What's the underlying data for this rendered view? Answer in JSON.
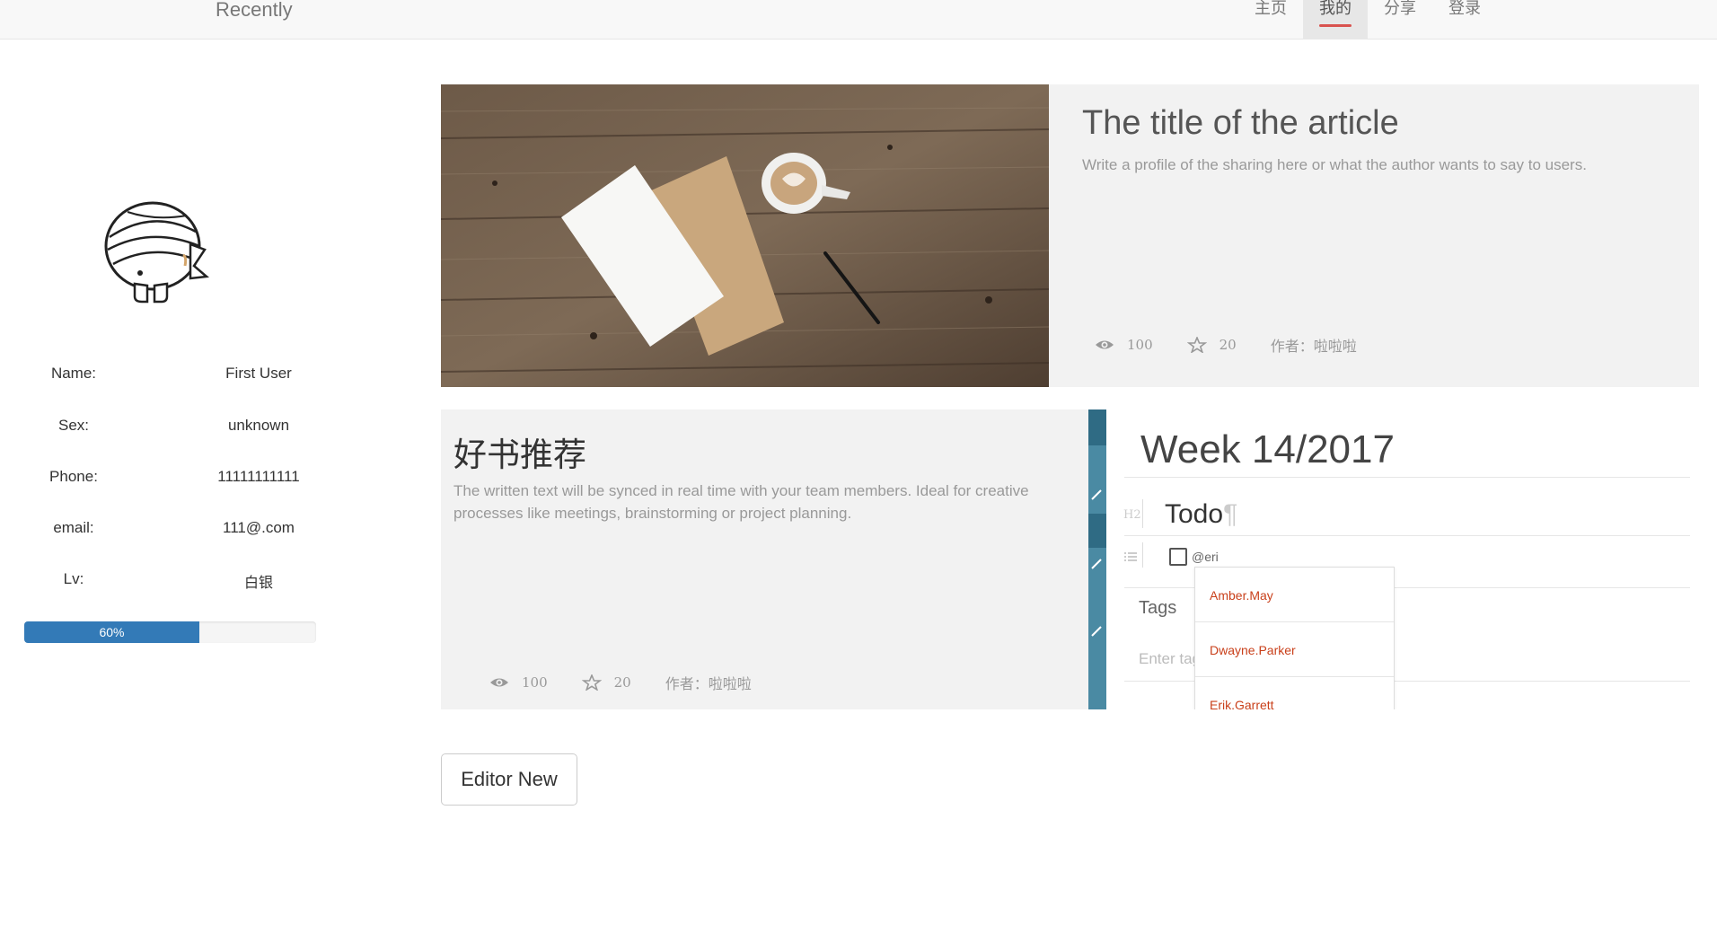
{
  "navbar": {
    "brand": "Recently",
    "items": [
      {
        "label": "主页",
        "active": false
      },
      {
        "label": "我的",
        "active": true
      },
      {
        "label": "分享",
        "active": false
      },
      {
        "label": "登录",
        "active": false
      }
    ]
  },
  "profile": {
    "fields": [
      {
        "label": "Name:",
        "value": "First User"
      },
      {
        "label": "Sex:",
        "value": "unknown"
      },
      {
        "label": "Phone:",
        "value": "11111111111"
      },
      {
        "label": "email:",
        "value": "111@.com"
      },
      {
        "label": "Lv:",
        "value": "白银"
      }
    ],
    "progress": {
      "label": "60%",
      "fraction": 0.6
    }
  },
  "articles": [
    {
      "title": "The title of the article",
      "description": "Write a profile of the sharing here or what the author wants to say to users.",
      "views": "100",
      "stars": "20",
      "author": "作者：啦啦啦"
    },
    {
      "title": "好书推荐",
      "description": "The written text will be synced in real time with your team members. Ideal for creative processes like meetings, brainstorming or project planning.",
      "views": "100",
      "stars": "20",
      "author": "作者：啦啦啦",
      "preview": {
        "heading": "Week 14/2017",
        "h2_mark": "H2",
        "todo": "Todo",
        "pilcrow": "¶",
        "mention": "@eri",
        "tags_label": "Tags",
        "tags_placeholder": "Enter tag",
        "suggestions": [
          "Amber.May",
          "Dwayne.Parker",
          "Erik.Garrett"
        ]
      }
    }
  ],
  "editor_button": "Editor New",
  "colors": {
    "progress": "#337ab7",
    "nav_active_underline": "#d9534f",
    "card_bg": "#f2f2f2",
    "preview_strip": "#4a8aa3",
    "mention_text": "#c9401b"
  },
  "icons": {
    "views": "eye-icon",
    "stars": "star-icon",
    "avatar": "bandaged-head-avatar"
  }
}
